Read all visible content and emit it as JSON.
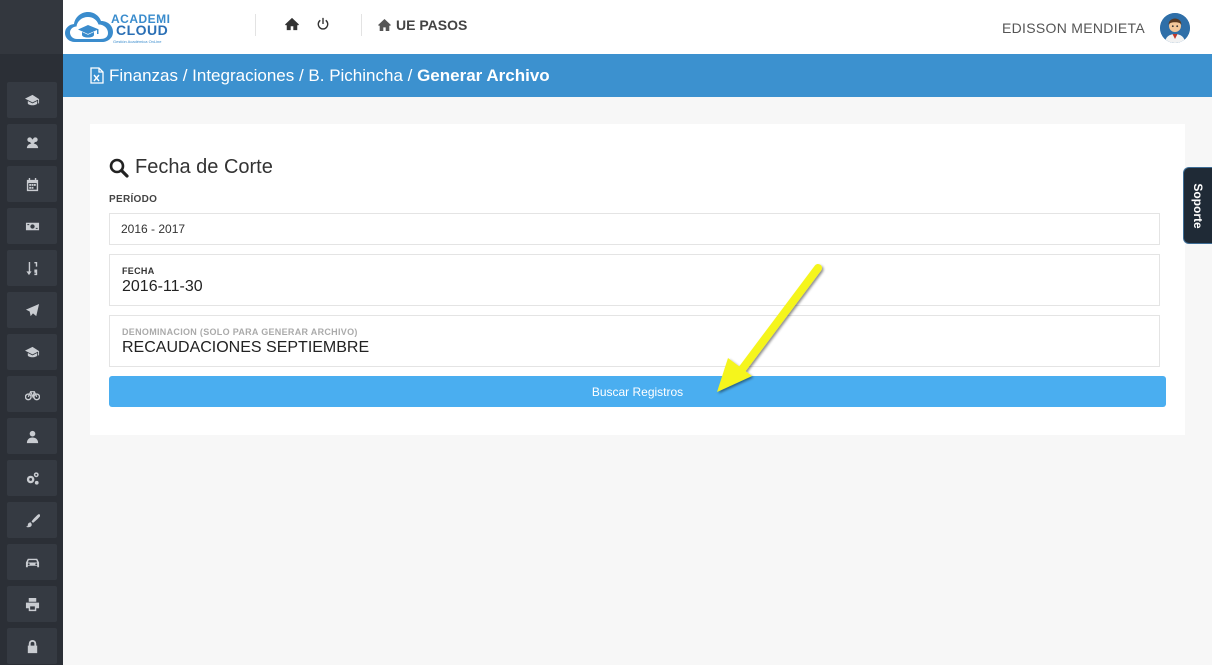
{
  "header": {
    "logo_line1": "ACADEMI",
    "logo_line2": "CLOUD",
    "logo_tagline": "Gestión Académica OnLine",
    "school_name": "UE PASOS",
    "user_name": "EDISSON MENDIETA"
  },
  "sidebar": {
    "items": [
      {
        "icon": "graduation-cap-icon"
      },
      {
        "icon": "users-icon"
      },
      {
        "icon": "calendar-icon"
      },
      {
        "icon": "money-icon"
      },
      {
        "icon": "sort-numeric-icon"
      },
      {
        "icon": "paper-plane-icon"
      },
      {
        "icon": "graduation-cap-icon"
      },
      {
        "icon": "bicycle-icon"
      },
      {
        "icon": "user-icon"
      },
      {
        "icon": "cogs-icon"
      },
      {
        "icon": "paint-brush-icon"
      },
      {
        "icon": "car-icon"
      },
      {
        "icon": "print-icon"
      },
      {
        "icon": "lock-icon"
      }
    ]
  },
  "breadcrumb": {
    "parts": [
      "Finanzas",
      "Integraciones",
      "B. Pichincha"
    ],
    "separator": " / ",
    "current": "Generar Archivo"
  },
  "form": {
    "title": "Fecha de Corte",
    "periodo_label": "PERÍODO",
    "periodo_value": "2016 - 2017",
    "fecha_label": "FECHA",
    "fecha_value": "2016-11-30",
    "denominacion_label": "DENOMINACION (SOLO PARA GENERAR ARCHIVO)",
    "denominacion_value": "RECAUDACIONES SEPTIEMBRE",
    "submit_label": "Buscar Registros"
  },
  "support_tab": {
    "label": "Soporte"
  },
  "colors": {
    "accent": "#3c91cf",
    "button": "#4aaef0",
    "sidebar": "#2b2f36",
    "annotation_arrow": "#f5f51f"
  }
}
